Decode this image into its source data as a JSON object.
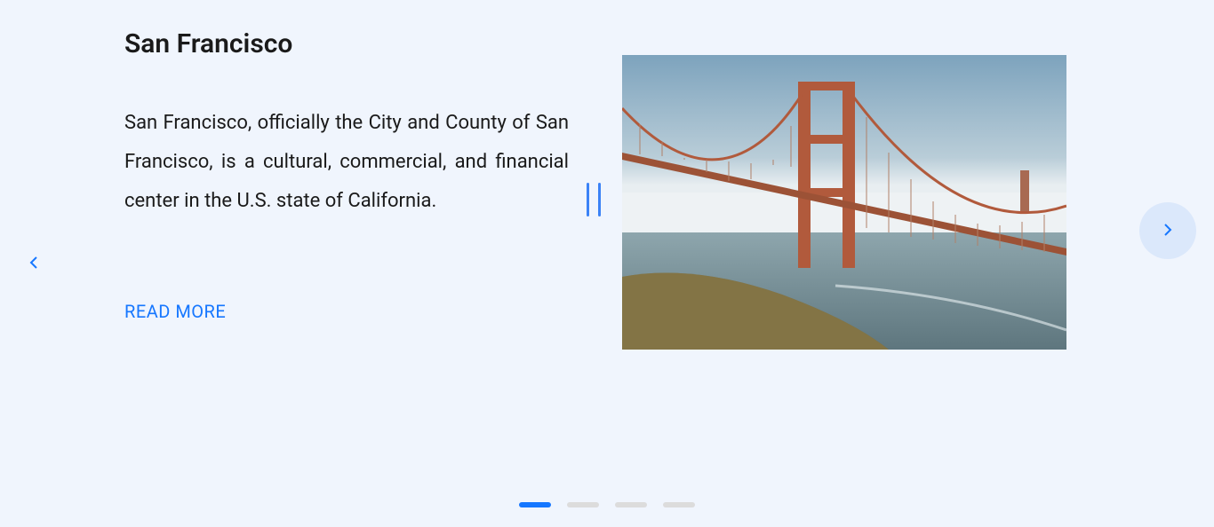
{
  "slide": {
    "title": "San Francisco",
    "description": "San Francisco, officially the City and County of San Francisco, is a cultural, commercial, and financial center in the U.S. state of California.",
    "read_more_label": "READ MORE"
  },
  "carousel": {
    "total_slides": 4,
    "active_index": 0
  }
}
